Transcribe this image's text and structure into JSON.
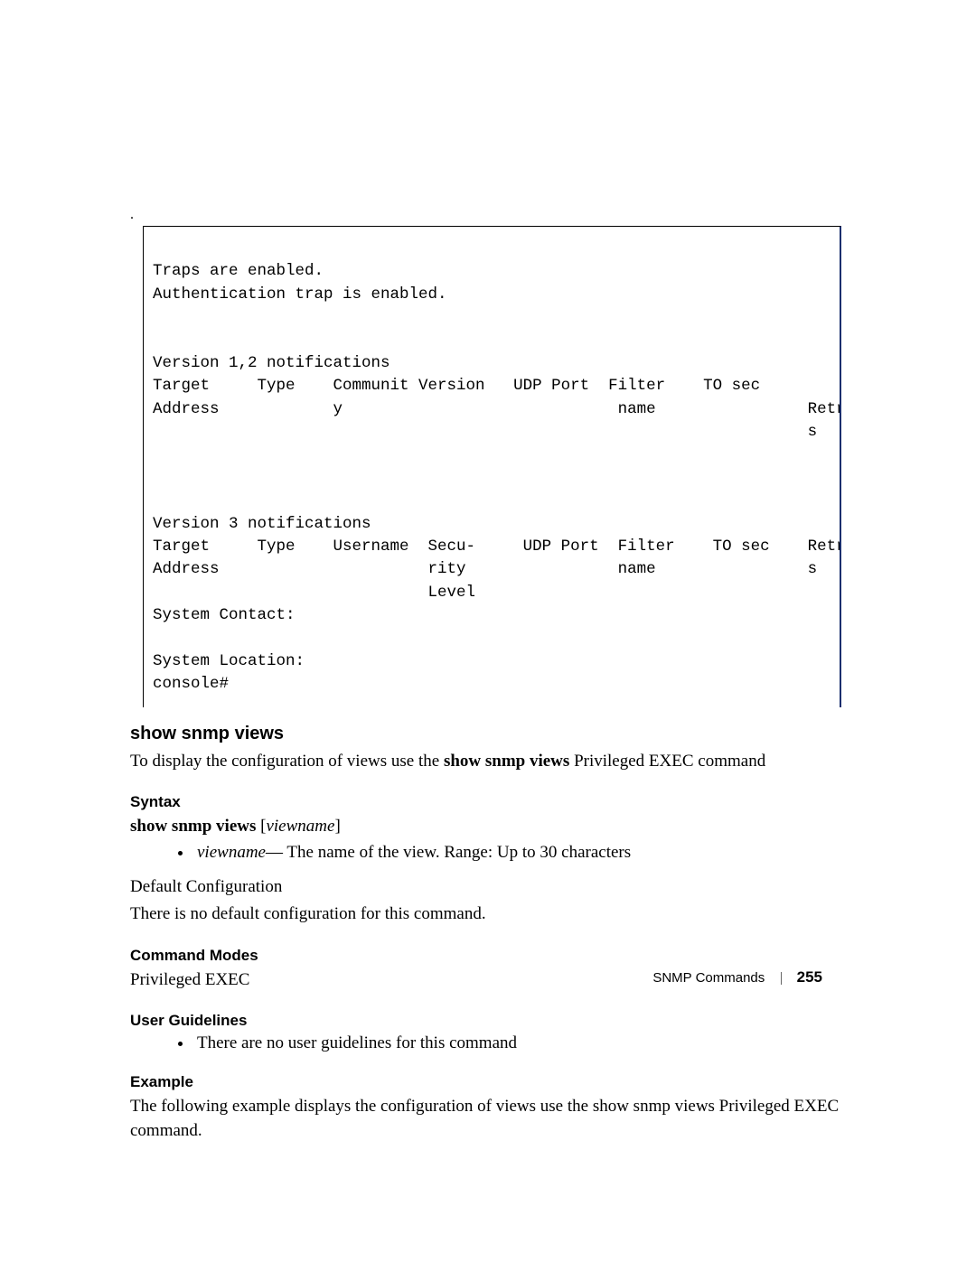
{
  "codebox": {
    "l1": "Traps are enabled.",
    "l2": "Authentication trap is enabled.",
    "blank1": "",
    "blank2": "",
    "l3": "Version 1,2 notifications",
    "hdr1_l1": "Target     Type    Communit Version   UDP Port  Filter    TO sec",
    "hdr1_l2": "Address            y                             name                Retrie",
    "hdr1_l3": "                                                                     s",
    "blank3": "",
    "blank4": "",
    "blank5": "",
    "l4": "Version 3 notifications",
    "hdr2_l1": "Target     Type    Username  Secu-     UDP Port  Filter    TO sec    Retrie",
    "hdr2_l2": "Address                      rity                name                s",
    "hdr2_l3": "                             Level",
    "l5": "System Contact:",
    "blank6": "",
    "l6": "System Location:",
    "l7": "console#"
  },
  "section_title": "show snmp views",
  "intro_pre": "To display the configuration of views use the ",
  "intro_bold": "show snmp views",
  "intro_post": " Privileged EXEC command",
  "syntax": {
    "heading": "Syntax",
    "cmd_bold": "show snmp views",
    "cmd_bracket_open": " [",
    "cmd_arg": "viewname",
    "cmd_bracket_close": "]",
    "param_name": "viewname",
    "param_dash": "— ",
    "param_text": "The name of the view. Range: Up to 30 characters"
  },
  "default_cfg": {
    "label": "Default Configuration",
    "text": "There is no default configuration for this command."
  },
  "cmd_modes": {
    "heading": "Command Modes",
    "text": "Privileged EXEC"
  },
  "guidelines": {
    "heading": "User Guidelines",
    "text": "There are no user guidelines for this command"
  },
  "example": {
    "heading": "Example",
    "text": "The following example displays the configuration of views use the show snmp views Privileged EXEC command."
  },
  "footer": {
    "section": "SNMP Commands",
    "page": "255"
  }
}
